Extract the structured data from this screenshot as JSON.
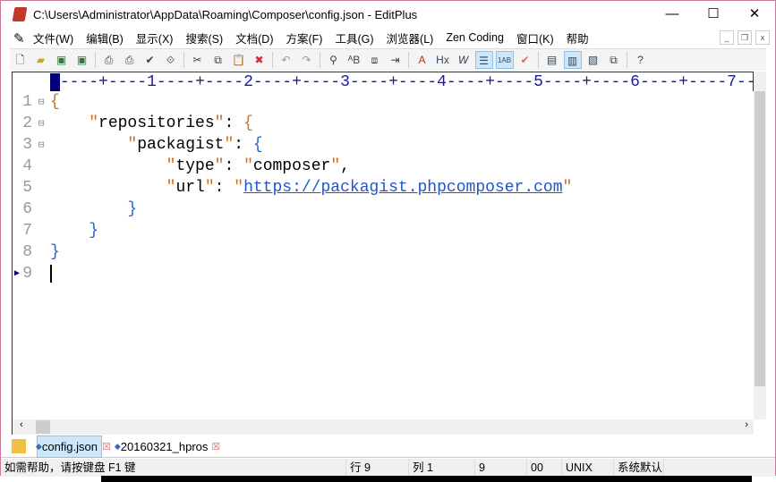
{
  "window": {
    "title": "C:\\Users\\Administrator\\AppData\\Roaming\\Composer\\config.json - EditPlus"
  },
  "menu": [
    "文件(W)",
    "编辑(B)",
    "显示(X)",
    "搜索(S)",
    "文档(D)",
    "方案(F)",
    "工具(G)",
    "浏览器(L)",
    "Zen Coding",
    "窗口(K)",
    "帮助"
  ],
  "ruler": "----+----1----+----2----+----3----+----4----+----5----+----6----+----7--",
  "editor": {
    "lines": [
      {
        "n": "1",
        "fold": "⊟"
      },
      {
        "n": "2",
        "fold": "⊟"
      },
      {
        "n": "3",
        "fold": "⊟"
      },
      {
        "n": "4"
      },
      {
        "n": "5"
      },
      {
        "n": "6"
      },
      {
        "n": "7"
      },
      {
        "n": "8"
      },
      {
        "n": "9"
      }
    ],
    "key1": "repositories",
    "key2": "packagist",
    "key3": "type",
    "val3": "composer",
    "key4": "url",
    "val4": "https://packagist.phpcomposer.com"
  },
  "tabs": [
    {
      "label": "config.json"
    },
    {
      "label": "20160321_hpros"
    }
  ],
  "status": {
    "help": "如需帮助，请按键盘 F1 键",
    "row": "行 9",
    "col": "列 1",
    "c3": "9",
    "c4": "00",
    "eol": "UNIX",
    "enc": "系统默认"
  }
}
